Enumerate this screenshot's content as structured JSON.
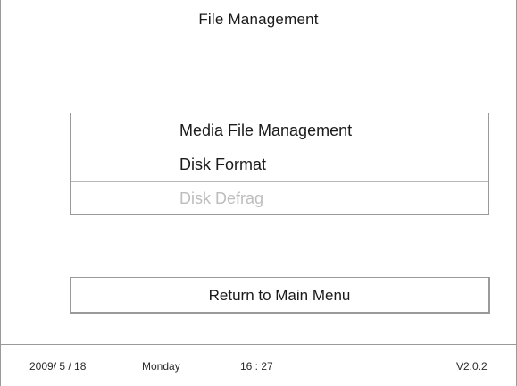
{
  "header": {
    "title": "File Management"
  },
  "menu": {
    "items": [
      {
        "label": "Media File Management",
        "enabled": true
      },
      {
        "label": "Disk Format",
        "enabled": true
      },
      {
        "label": "Disk Defrag",
        "enabled": false
      }
    ]
  },
  "actions": {
    "return_label": "Return to Main Menu"
  },
  "status": {
    "date": "2009/ 5 / 18",
    "day": "Monday",
    "time": "16 :  27",
    "version": "V2.0.2"
  },
  "colors": {
    "text": "#1a1a1a",
    "disabled_text": "#bdbdbd",
    "border": "#9a9a9a",
    "background": "#ffffff"
  }
}
